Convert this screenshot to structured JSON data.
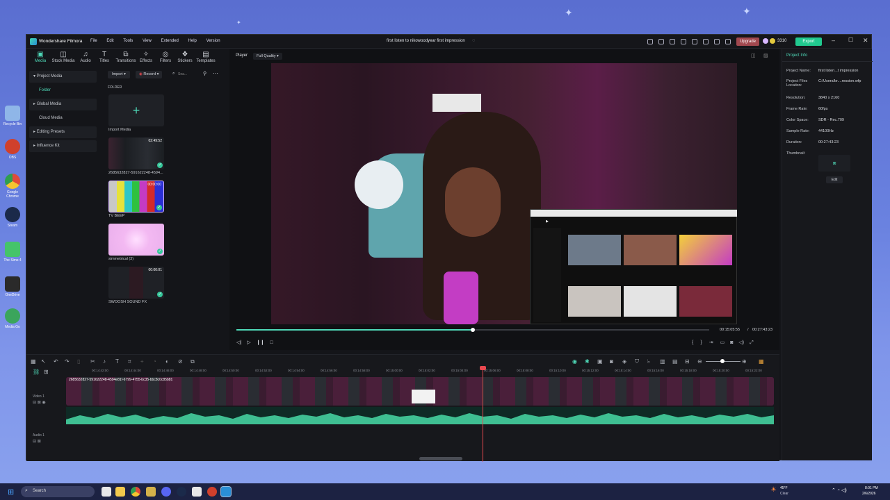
{
  "window": {
    "app_name": "Wondershare Filmora",
    "menus": [
      "File",
      "Edit",
      "Tools",
      "View",
      "Extended",
      "Help",
      "Version"
    ],
    "project_title": "first listen to nikowoodyear first impression",
    "upgrade_label": "Upgrade",
    "credits": "3310",
    "export_label": "Export"
  },
  "toolbar": {
    "tools": [
      {
        "label": "Media",
        "icon": "media-icon"
      },
      {
        "label": "Stock Media",
        "icon": "stock-media-icon"
      },
      {
        "label": "Audio",
        "icon": "music-note-icon"
      },
      {
        "label": "Titles",
        "icon": "text-icon"
      },
      {
        "label": "Transitions",
        "icon": "transitions-icon"
      },
      {
        "label": "Effects",
        "icon": "effects-icon"
      },
      {
        "label": "Filters",
        "icon": "filters-icon"
      },
      {
        "label": "Stickers",
        "icon": "stickers-icon"
      },
      {
        "label": "Templates",
        "icon": "templates-icon"
      }
    ]
  },
  "library": {
    "nav": [
      {
        "label": "Project Media"
      },
      {
        "label": "Folder"
      },
      {
        "label": "Global Media"
      },
      {
        "label": "Cloud Media"
      },
      {
        "label": "Editing Presets"
      },
      {
        "label": "Influence Kit"
      }
    ],
    "import_label": "Import",
    "record_label": "Record",
    "search_placeholder": "Sea...",
    "folder_header": "FOLDER",
    "items": [
      {
        "label": "Import Media",
        "duration": ""
      },
      {
        "label": "2685632827-591622248-4594...",
        "duration": "02:49:52"
      },
      {
        "label": "TV BEEP",
        "duration": "00:00:00"
      },
      {
        "label": "simmetrical (3)",
        "duration": ""
      },
      {
        "label": "SWOOSH SOUND FX",
        "duration": "00:00:01"
      }
    ]
  },
  "player": {
    "label": "Player",
    "quality": "Full Quality",
    "current_time": "00:15:05:55",
    "separator": "/",
    "total_time": "00:27:43:23",
    "progress": 0.5
  },
  "project_info": {
    "tab": "Project Info",
    "rows": [
      {
        "label": "Project Name:",
        "value": "first listen...t impression"
      },
      {
        "label": "Project Files Location:",
        "value": "C:/Users/br....ression.wfp"
      },
      {
        "label": "Resolution:",
        "value": "3840 x 2160"
      },
      {
        "label": "Frame Rate:",
        "value": "60fps"
      },
      {
        "label": "Color Space:",
        "value": "SDR - Rec.709"
      },
      {
        "label": "Sample Rate:",
        "value": "44100Hz"
      },
      {
        "label": "Duration:",
        "value": "00:27:43:23"
      },
      {
        "label": "Thumbnail:",
        "value": ""
      }
    ],
    "edit_label": "Edit"
  },
  "timeline": {
    "ruler": [
      "00:14:42:00",
      "00:14:44:00",
      "00:14:46:00",
      "00:14:48:00",
      "00:14:50:00",
      "00:14:52:00",
      "00:14:54:00",
      "00:14:56:00",
      "00:14:58:00",
      "00:15:00:00",
      "00:15:02:00",
      "00:15:04:00",
      "00:15:06:00",
      "00:15:08:00",
      "00:15:10:00",
      "00:15:12:00",
      "00:15:14:00",
      "00:15:16:00",
      "00:15:18:00",
      "00:15:20:00",
      "00:15:22:00"
    ],
    "clip_name": "2685632827-591622248-4594e81f-6799-4755-bc35-bbc8c0c85b81",
    "video_track": "Video 1",
    "audio_track": "Audio 1"
  },
  "taskbar": {
    "search_placeholder": "Search",
    "temperature": "45°F",
    "weather": "Clear",
    "time": "8:01 PM",
    "date": "2/6/2026"
  },
  "desktop": {
    "icons": [
      {
        "label": "Recycle Bin"
      },
      {
        "label": "OBS"
      },
      {
        "label": "Google Chrome"
      },
      {
        "label": "Steam"
      },
      {
        "label": "The Sims 4"
      },
      {
        "label": "OneDrive"
      },
      {
        "label": "Media Go"
      }
    ]
  },
  "colors": {
    "accent": "#3fd6b0",
    "export": "#21c98f",
    "upgrade": "#a1484f",
    "playhead": "#e8484f"
  }
}
